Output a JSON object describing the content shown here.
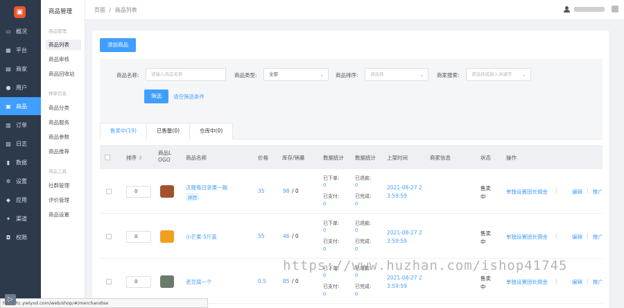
{
  "nav": {
    "items": [
      {
        "label": "概况",
        "icon": "monitor-icon",
        "glyph": "▭"
      },
      {
        "label": "平台",
        "icon": "platform-icon",
        "glyph": "▦"
      },
      {
        "label": "商家",
        "icon": "store-icon",
        "glyph": "▤"
      },
      {
        "label": "用户",
        "icon": "user-icon",
        "glyph": "●"
      },
      {
        "label": "商品",
        "icon": "goods-icon",
        "glyph": "▣"
      },
      {
        "label": "订单",
        "icon": "order-icon",
        "glyph": "▥"
      },
      {
        "label": "日志",
        "icon": "log-icon",
        "glyph": "▧"
      },
      {
        "label": "数据",
        "icon": "chart-icon",
        "glyph": "▮"
      },
      {
        "label": "设置",
        "icon": "gear-icon",
        "glyph": "✲"
      },
      {
        "label": "应用",
        "icon": "apps-icon",
        "glyph": "◆"
      },
      {
        "label": "渠道",
        "icon": "channel-icon",
        "glyph": "✦"
      },
      {
        "label": "权限",
        "icon": "lock-icon",
        "glyph": "◘"
      }
    ],
    "active_index": 4
  },
  "subnav": {
    "title": "商品管理",
    "groups": [
      {
        "label": "商品管理",
        "items": [
          "商品列表",
          "商品审核",
          "商品回收站"
        ]
      },
      {
        "label": "种草信息",
        "items": [
          "商品分类",
          "商品服务",
          "商品参数",
          "商品推荐"
        ]
      },
      {
        "label": "商品工具",
        "items": [
          "社群管理",
          "评价管理",
          "商品设置"
        ]
      }
    ],
    "active_item": "商品列表"
  },
  "breadcrumb": {
    "root": "页面",
    "separator": "/",
    "current": "商品列表"
  },
  "toolbar": {
    "add_label": "添加商品"
  },
  "filter": {
    "name_label": "商品名称:",
    "name_placeholder": "请输入商品名称",
    "type_label": "商品类型:",
    "type_value": "全部",
    "sort_label": "商品排序:",
    "sort_placeholder": "请选择",
    "merchant_label": "商家搜索:",
    "merchant_placeholder": "请选择或输入关键字",
    "submit_label": "筛选",
    "clear_label": "清空筛选条件"
  },
  "tabs": [
    "售卖中(19)",
    "已售罄(0)",
    "仓库中(0)"
  ],
  "table": {
    "headers": {
      "sort": "排序",
      "logo_line1": "商品L",
      "logo_line2": "OGO",
      "name": "商品名称",
      "price": "价格",
      "stock": "库存/销量",
      "stats1": "数据统计",
      "stats2": "数据统计",
      "time": "上架时间",
      "merchant": "商家信息",
      "status": "状态",
      "actions": "操作"
    },
    "rows": [
      {
        "sort": "0",
        "name": "沃隆每日坚果一箱",
        "tag": "拼团",
        "price": "35",
        "stock": "98",
        "sold": "/ 0",
        "ordered_label": "已下单:",
        "ordered": "0",
        "paid_label": "已支付:",
        "paid": "0",
        "refund_label": "已退款:",
        "refund": "0",
        "done_label": "已完成:",
        "done": "0",
        "time_line1": "2021-08-27 2",
        "time_line2": "3:59:59",
        "status_line1": "售卖",
        "status_line2": "中",
        "action1": "单独设置团长佣金",
        "action2": "编辑",
        "action3": "推广",
        "thumb_color": "#a0522d"
      },
      {
        "sort": "0",
        "name": "小芒果 5斤装",
        "tag": "",
        "price": "55",
        "stock": "46",
        "sold": "/ 0",
        "ordered_label": "已下单:",
        "ordered": "0",
        "paid_label": "已支付:",
        "paid": "0",
        "refund_label": "已退款:",
        "refund": "0",
        "done_label": "已完成:",
        "done": "0",
        "time_line1": "2021-08-27 2",
        "time_line2": "3:59:59",
        "status_line1": "售卖",
        "status_line2": "中",
        "action1": "单独设置团长佣金",
        "action2": "编辑",
        "action3": "推广",
        "thumb_color": "#f0a020"
      },
      {
        "sort": "0",
        "name": "老豆腐一个",
        "tag": "",
        "price": "0.5",
        "stock": "85",
        "sold": "/ 0",
        "ordered_label": "已下单:",
        "ordered": "0",
        "paid_label": "已支付:",
        "paid": "0",
        "refund_label": "已退款:",
        "refund": "0",
        "done_label": "已完成:",
        "done": "0",
        "time_line1": "2021-08-27 2",
        "time_line2": "3:59:59",
        "status_line1": "售卖",
        "status_line2": "中",
        "action1": "单独设置团长佣金",
        "action2": "编辑",
        "action3": "推广",
        "thumb_color": "#6b7b6b"
      }
    ]
  },
  "status_bar": {
    "url": "http://tc.ywlyxd.com/web/shop/#/merchandise"
  },
  "watermark": "https://www.huzhan.com/ishop41745",
  "colors": {
    "accent": "#409eff",
    "nav_bg": "#2d3a4b",
    "logo": "#e8572d"
  }
}
